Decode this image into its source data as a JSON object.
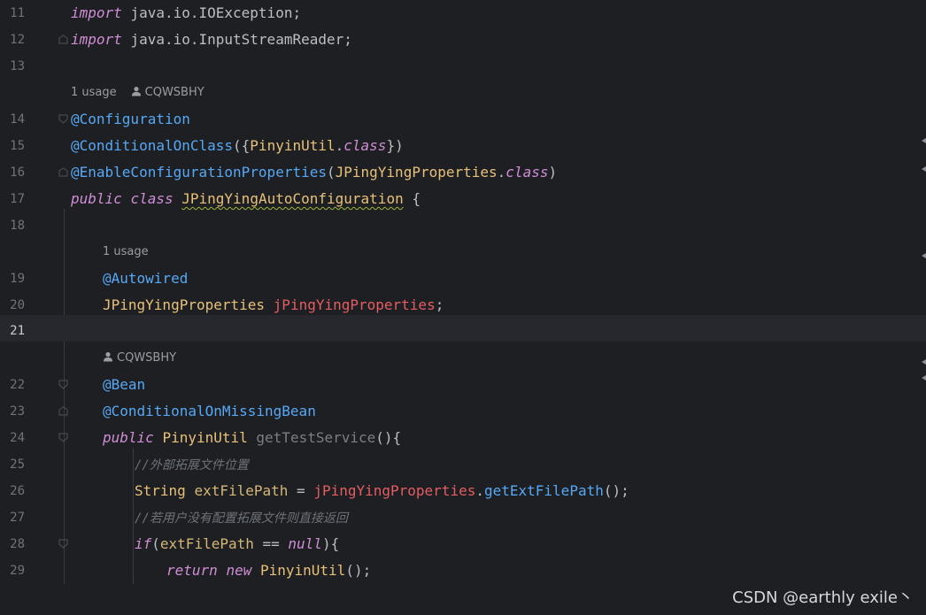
{
  "editor": {
    "language": "Java",
    "current_line": "21",
    "lines": {
      "l11": {
        "number": "11",
        "kw": "import",
        "text": " java.io.IOException;"
      },
      "l12": {
        "number": "12",
        "kw": "import",
        "text": " java.io.InputStreamReader;"
      },
      "l13": {
        "number": "13"
      },
      "hint1": {
        "usage": "1 usage",
        "author": "CQWSBHY"
      },
      "l14": {
        "number": "14",
        "ann": "@Configuration"
      },
      "l15": {
        "number": "15",
        "ann": "@ConditionalOnClass",
        "p1": "({",
        "cls": "PinyinUtil",
        "dot": ".",
        "kw": "class",
        "p2": "})"
      },
      "l16": {
        "number": "16",
        "ann": "@EnableConfigurationProperties",
        "p1": "(",
        "cls": "JPingYingProperties",
        "dot": ".",
        "kw": "class",
        "p2": ")"
      },
      "l17": {
        "number": "17",
        "kw1": "public",
        "kw2": "class",
        "cls": "JPingYingAutoConfiguration",
        "brace": " {"
      },
      "l18": {
        "number": "18"
      },
      "hint2": {
        "usage": "1 usage"
      },
      "l19": {
        "number": "19",
        "ann": "@Autowired"
      },
      "l20": {
        "number": "20",
        "cls": "JPingYingProperties",
        "fld": "jPingYingProperties",
        "semi": ";"
      },
      "l21": {
        "number": "21"
      },
      "hint3": {
        "author": "CQWSBHY"
      },
      "l22": {
        "number": "22",
        "ann": "@Bean"
      },
      "l23": {
        "number": "23",
        "ann": "@ConditionalOnMissingBean"
      },
      "l24": {
        "number": "24",
        "kw": "public",
        "cls": "PinyinUtil",
        "mth": "getTestService",
        "rest": "(){"
      },
      "l25": {
        "number": "25",
        "comment": "//外部拓展文件位置"
      },
      "l26": {
        "number": "26",
        "cls": "String",
        "var": "extFilePath",
        "eq": " = ",
        "fld": "jPingYingProperties",
        "dot": ".",
        "mth": "getExtFilePath",
        "rest": "();"
      },
      "l27": {
        "number": "27",
        "comment": "//若用户没有配置拓展文件则直接返回"
      },
      "l28": {
        "number": "28",
        "kw": "if",
        "p1": "(",
        "var": "extFilePath",
        "op": " == ",
        "kw2": "null",
        "p2": "){"
      },
      "l29": {
        "number": "29",
        "kw1": "return",
        "kw2": "new",
        "cls": "PinyinUtil",
        "rest": "();"
      }
    }
  },
  "watermark": "CSDN @earthly exile丶",
  "colors": {
    "background": "#1e1f22",
    "keyword": "#cf8ed6",
    "annotation": "#56a8f5",
    "class": "#e7c17a",
    "field": "#e45d63",
    "comment": "#6d727a"
  }
}
